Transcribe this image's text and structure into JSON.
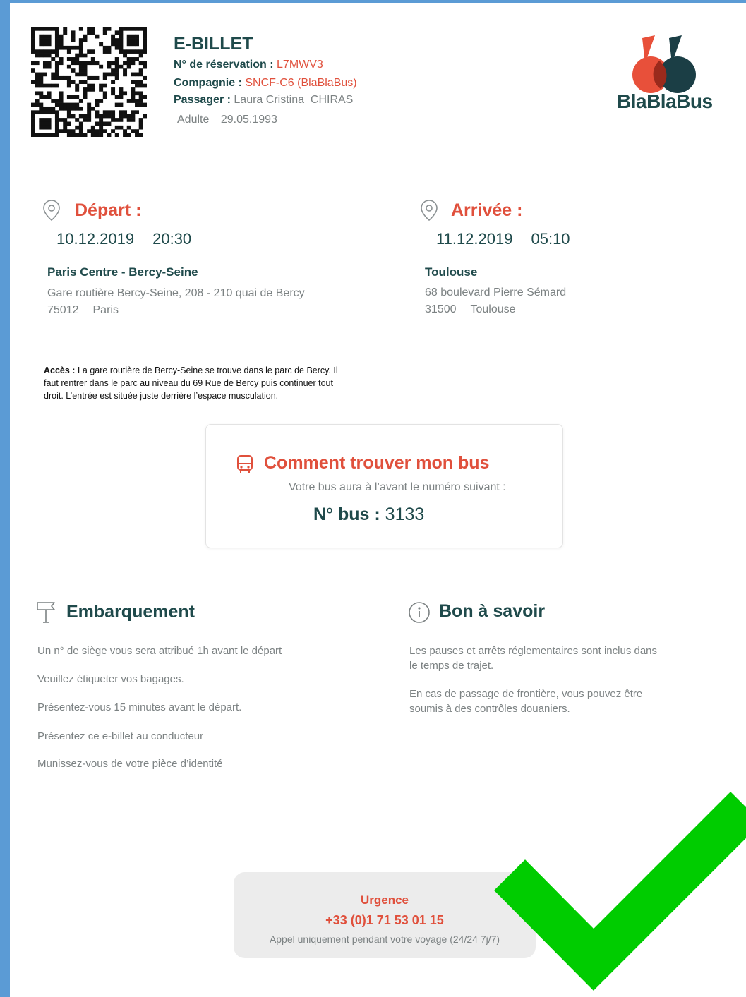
{
  "header": {
    "title": "E-BILLET",
    "reservation_label": "N° de réservation :",
    "reservation_value": "L7MWV3",
    "company_label": "Compagnie :",
    "company_value": "SNCF-C6 (BlaBlaBus)",
    "passenger_label": "Passager :",
    "passenger_value": "Laura Cristina  CHIRAS",
    "passenger_type": "Adulte",
    "birth_date": "29.05.1993"
  },
  "logo": {
    "text": "BlaBlaBus",
    "colors": {
      "red": "#e8503a",
      "dark": "#1b3e45",
      "text": "#1f4a4b"
    }
  },
  "departure": {
    "heading": "Départ :",
    "date": "10.12.2019",
    "time": "20:30",
    "station": "Paris Centre - Bercy-Seine",
    "address_line1": "Gare routière Bercy-Seine, 208 - 210 quai de Bercy",
    "postal_code": "75012",
    "city": "Paris"
  },
  "arrival": {
    "heading": "Arrivée :",
    "date": "11.12.2019",
    "time": "05:10",
    "station": "Toulouse",
    "address_line1": "68 boulevard Pierre Sémard",
    "postal_code": "31500",
    "city": "Toulouse"
  },
  "access": {
    "label": "Accès :",
    "text": " La gare routière de Bercy-Seine se trouve dans le parc de Bercy. Il faut rentrer dans le parc au niveau du 69 Rue de Bercy puis continuer tout droit. L’entrée est située juste derrière l’espace musculation."
  },
  "bus_box": {
    "heading": "Comment trouver mon bus",
    "subtitle": "Votre bus aura à l’avant le numéro suivant :",
    "bus_label": "N° bus :",
    "bus_number": "3133"
  },
  "boarding": {
    "heading": "Embarquement",
    "items": [
      "Un n° de siège vous sera attribué 1h avant le départ",
      "Veuillez étiqueter vos bagages.",
      "Présentez-vous 15 minutes avant le départ.",
      "Présentez ce e-billet au conducteur",
      "Munissez-vous de votre pièce d’identité"
    ]
  },
  "good_to_know": {
    "heading": "Bon à savoir",
    "p1_line1": "Les pauses et arrêts réglementaires sont inclus dans",
    "p1_line2": "le temps de trajet.",
    "p2_line1": "En cas de passage de frontière, vous pouvez être",
    "p2_line2": "soumis à des contrôles douaniers."
  },
  "emergency": {
    "heading": "Urgence",
    "phone": "+33 (0)1 71 53 01 15",
    "note": "Appel uniquement pendant votre voyage (24/24 7j/7)"
  },
  "colors": {
    "background": "#5b9bd5",
    "accent_red": "#e0503c",
    "teal": "#1f4a4b",
    "check_green": "#00cc00"
  },
  "icons": [
    "qr-code-icon",
    "location-pin-icon",
    "bus-icon",
    "signpost-icon",
    "info-icon",
    "checkmark-icon"
  ]
}
